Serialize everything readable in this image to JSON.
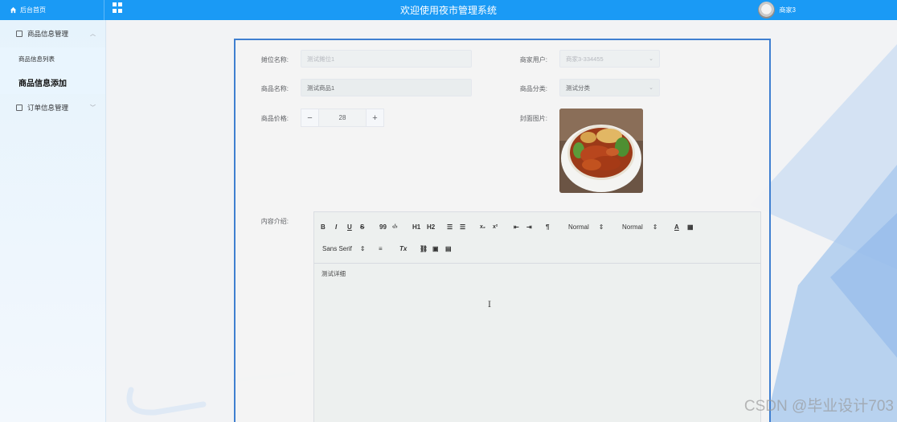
{
  "topbar": {
    "home_label": "后台首页",
    "title": "欢迎使用夜市管理系统",
    "username": "商家3"
  },
  "sidebar": {
    "groups": [
      {
        "label": "商品信息管理",
        "expanded": true,
        "items": [
          "商品信息列表",
          "商品信息添加"
        ]
      },
      {
        "label": "订单信息管理",
        "expanded": false
      }
    ],
    "active_item": "商品信息添加"
  },
  "form": {
    "stall_name": {
      "label": "摊位名称:",
      "value": "测试摊位1"
    },
    "merchant_user": {
      "label": "商家用户:",
      "value": "商家3-334455"
    },
    "product_name": {
      "label": "商品名称:",
      "value": "测试商品1"
    },
    "product_category": {
      "label": "商品分类:",
      "value": "测试分类"
    },
    "product_price": {
      "label": "商品价格:",
      "value": "28",
      "minus": "−",
      "plus": "+"
    },
    "cover_image": {
      "label": "封面图片:"
    },
    "content_intro": {
      "label": "内容介绍:",
      "text": "测试详细"
    }
  },
  "editor_toolbar": {
    "bold": "B",
    "italic": "I",
    "underline": "U",
    "strike": "S",
    "blockquote": "99",
    "code": "‹/›",
    "h1": "H1",
    "h2": "H2",
    "header_select": "Normal",
    "size_select": "Normal",
    "font_select": "Sans Serif"
  },
  "colors": {
    "topbar": "#1a9af5",
    "card_border": "#3f7fd0"
  },
  "watermark": "CSDN @毕业设计703"
}
